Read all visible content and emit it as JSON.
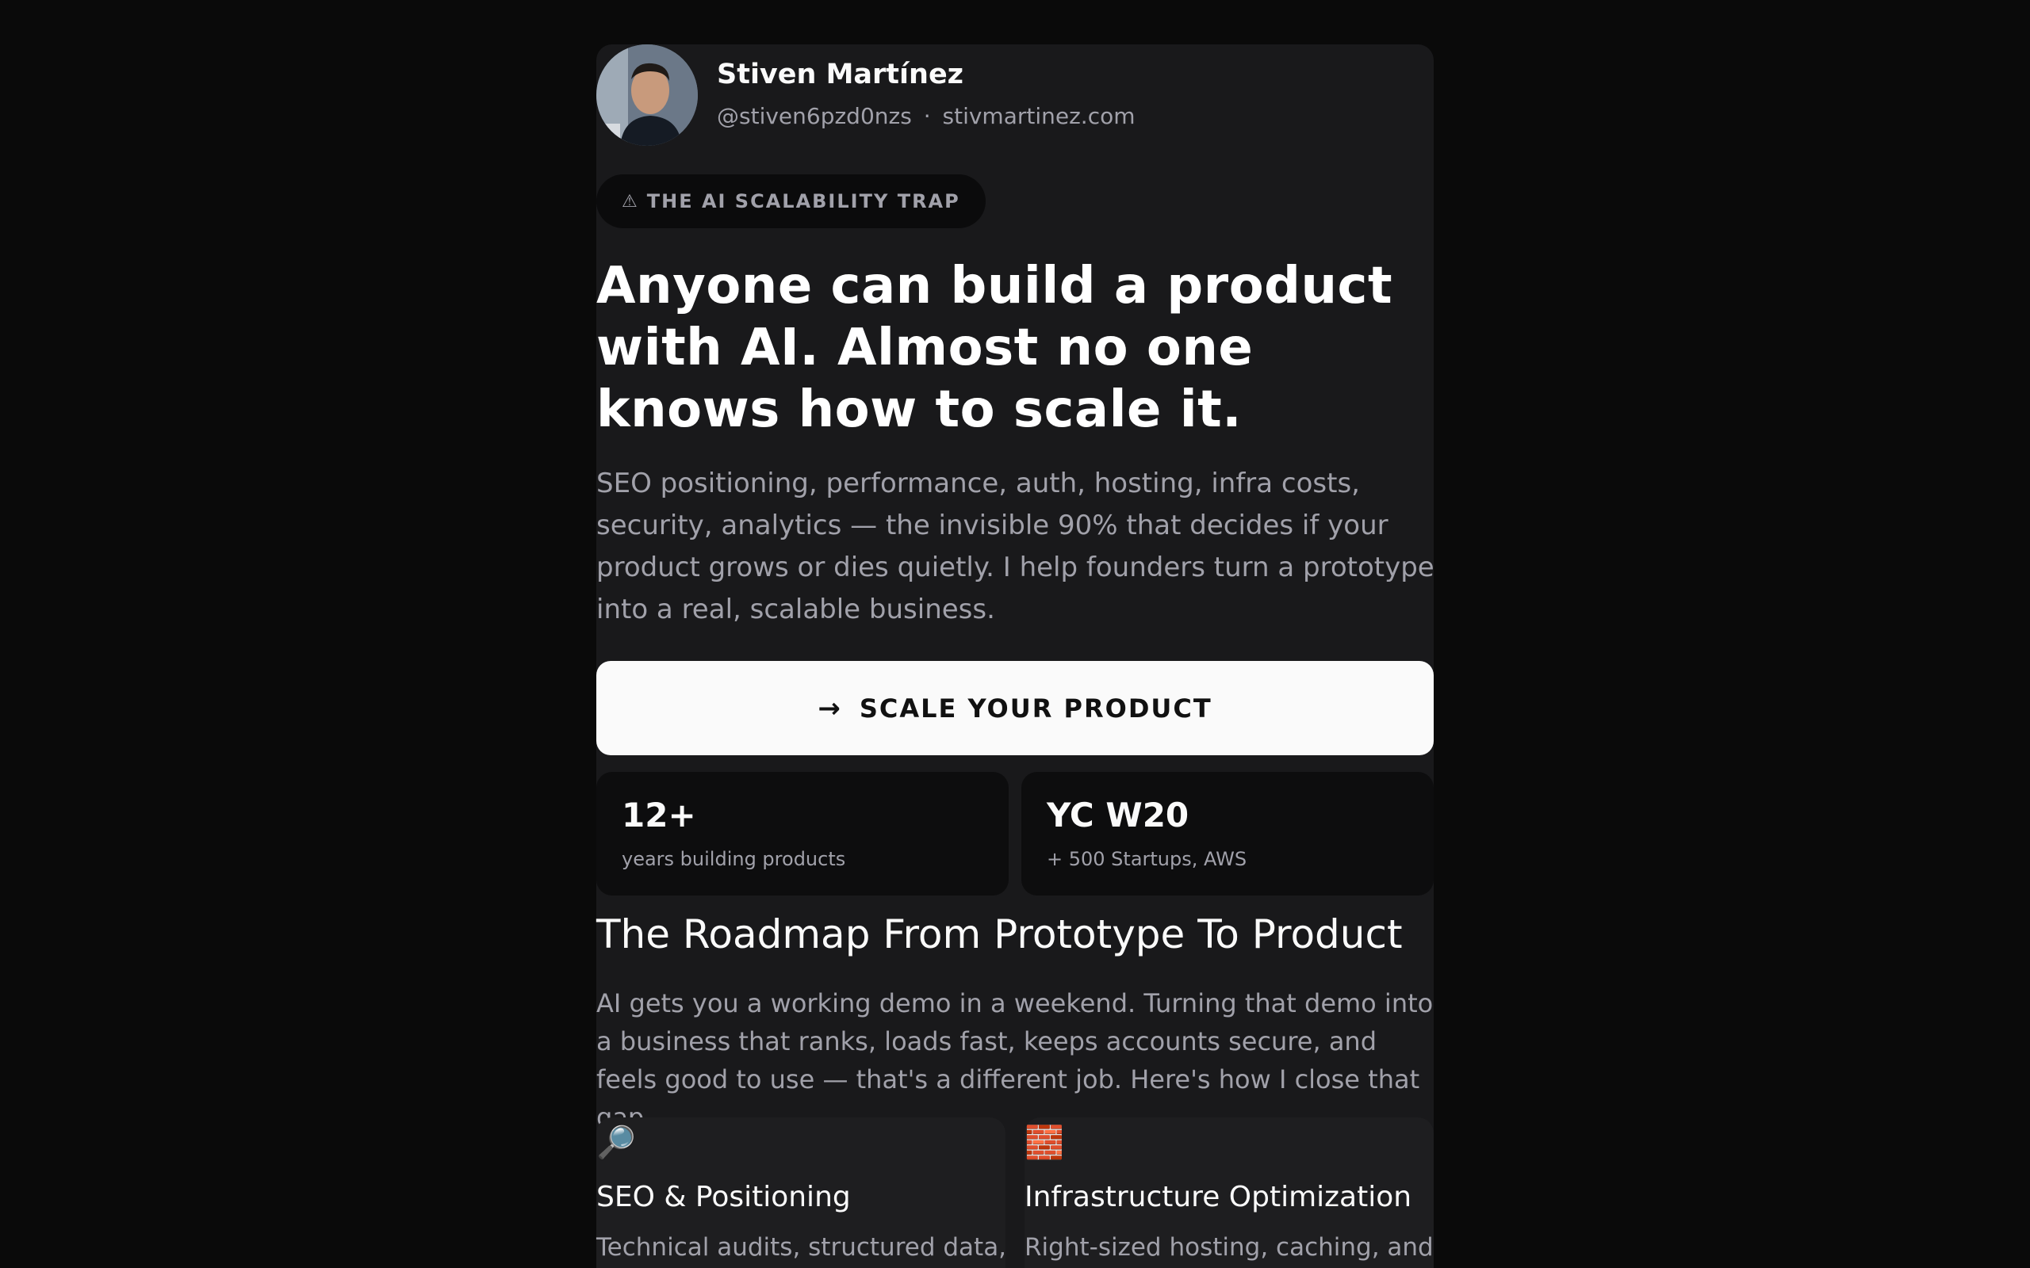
{
  "profile": {
    "name": "Stiven Martínez",
    "handle": "@stiven6pzd0nzs",
    "separator": "·",
    "website": "stivmartinez.com"
  },
  "badge": {
    "icon": "warning-triangle-icon",
    "label": "THE AI SCALABILITY TRAP"
  },
  "hero": {
    "headline": "Anyone can build a product with AI. Almost no one knows how to scale it.",
    "lead": "SEO positioning, performance, auth, hosting, infra costs, security, analytics — the invisible 90% that decides if your product grows or dies quietly. I help founders turn a prototype into a real, scalable business."
  },
  "cta": {
    "icon": "arrow-right-icon",
    "label": "SCALE YOUR PRODUCT"
  },
  "stats": [
    {
      "value": "12+",
      "label": "years building products"
    },
    {
      "value": "YC W20",
      "label": "+ 500 Startups, AWS"
    }
  ],
  "roadmap": {
    "title": "The Roadmap From Prototype To Product",
    "body": "AI gets you a working demo in a weekend. Turning that demo into a business that ranks, loads fast, keeps accounts secure, and feels good to use — that's a different job. Here's how I close that gap."
  },
  "features": [
    {
      "icon": "magnifying-glass-icon",
      "emoji": "🔎",
      "title": "SEO & Positioning",
      "desc": "Technical audits, structured data,"
    },
    {
      "icon": "bricks-icon",
      "emoji": "🧱",
      "title": "Infrastructure Optimization",
      "desc": "Right-sized hosting, caching, and"
    }
  ],
  "colors": {
    "page_bg": "#0a0a0a",
    "card_bg": "#19191b",
    "text_primary": "#fafafa",
    "text_muted": "#a1a1aa",
    "cta_bg": "#fafafa"
  }
}
